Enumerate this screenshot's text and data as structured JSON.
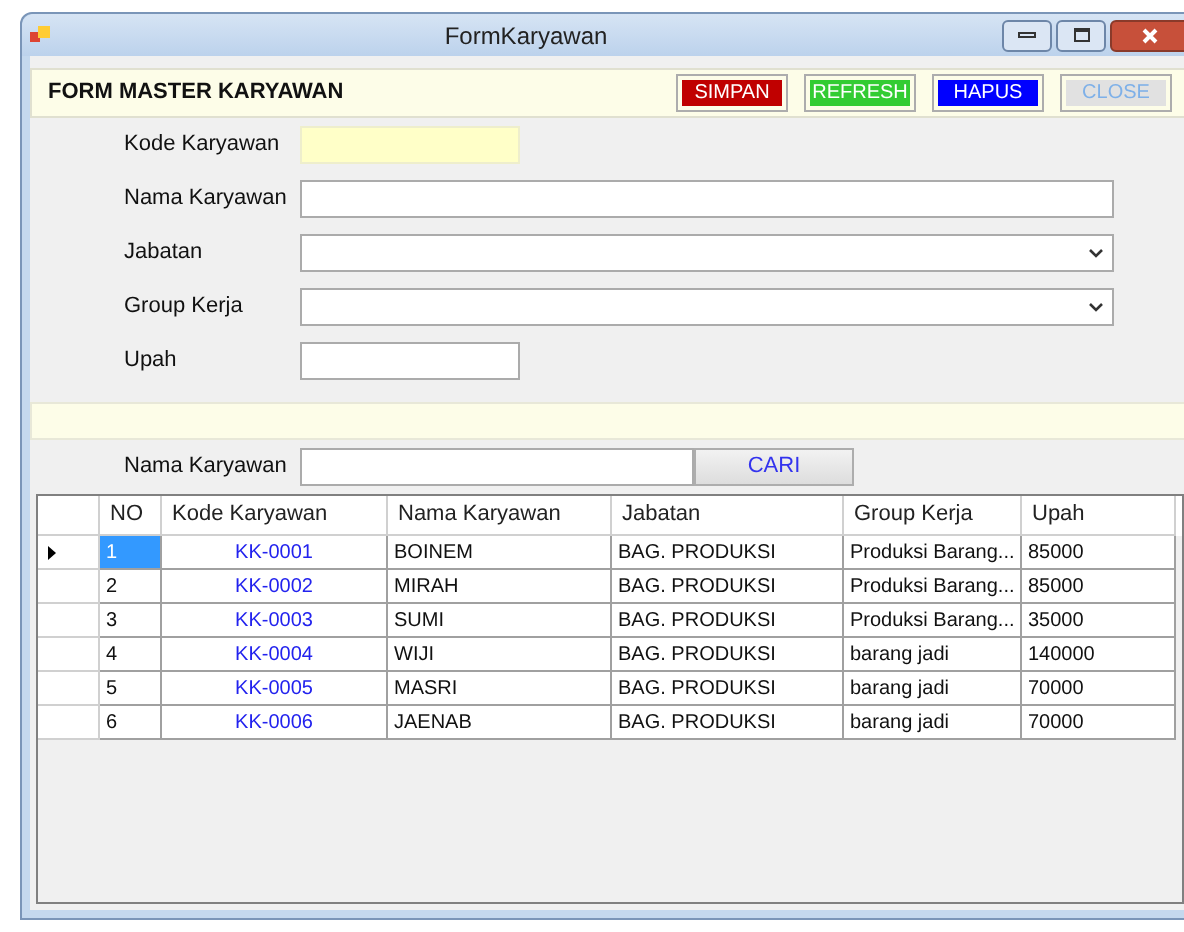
{
  "window": {
    "title": "FormKaryawan"
  },
  "header": {
    "title": "FORM MASTER KARYAWAN",
    "buttons": [
      {
        "label": "SIMPAN",
        "color": "#c00000",
        "disabled": false
      },
      {
        "label": "REFRESH",
        "color": "#33cc33",
        "disabled": false
      },
      {
        "label": "HAPUS",
        "color": "#0000ff",
        "disabled": false
      },
      {
        "label": "CLOSE",
        "color": "#e1e1e1",
        "disabled": true
      }
    ]
  },
  "form": [
    {
      "label": "Kode Karyawan",
      "kind": "text",
      "readonly": true,
      "wide": false
    },
    {
      "label": "Nama Karyawan",
      "kind": "text",
      "readonly": false,
      "wide": true
    },
    {
      "label": "Jabatan",
      "kind": "select",
      "wide": true
    },
    {
      "label": "Group Kerja",
      "kind": "select",
      "wide": true
    },
    {
      "label": "Upah",
      "kind": "text",
      "readonly": false,
      "wide": false
    }
  ],
  "search": {
    "label": "Nama Karyawan",
    "button": "CARI"
  },
  "table": {
    "columns": [
      "NO",
      "Kode Karyawan",
      "Nama Karyawan",
      "Jabatan",
      "Group Kerja",
      "Upah"
    ],
    "rows": [
      {
        "selected": true,
        "cells": [
          "1",
          "KK-0001",
          "BOINEM",
          "BAG. PRODUKSI",
          "Produksi Barang...",
          "85000"
        ]
      },
      {
        "selected": false,
        "cells": [
          "2",
          "KK-0002",
          "MIRAH",
          "BAG. PRODUKSI",
          "Produksi Barang...",
          "85000"
        ]
      },
      {
        "selected": false,
        "cells": [
          "3",
          "KK-0003",
          "SUMI",
          "BAG. PRODUKSI",
          "Produksi Barang...",
          "35000"
        ]
      },
      {
        "selected": false,
        "cells": [
          "4",
          "KK-0004",
          "WIJI",
          "BAG. PRODUKSI",
          "barang jadi",
          "140000"
        ]
      },
      {
        "selected": false,
        "cells": [
          "5",
          "KK-0005",
          "MASRI",
          "BAG. PRODUKSI",
          "barang jadi",
          "70000"
        ]
      },
      {
        "selected": false,
        "cells": [
          "6",
          "KK-0006",
          "JAENAB",
          "BAG. PRODUKSI",
          "barang jadi",
          "70000"
        ]
      }
    ]
  }
}
